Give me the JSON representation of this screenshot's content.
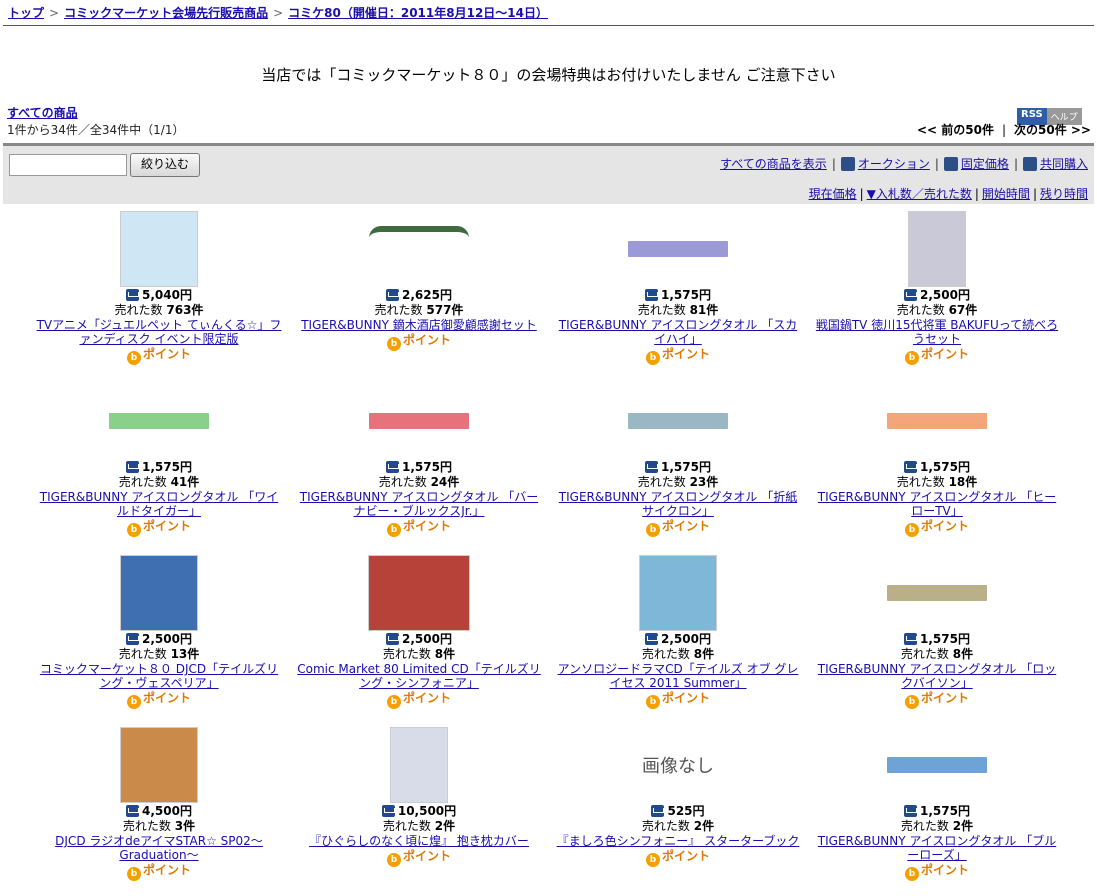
{
  "breadcrumb": [
    "トップ",
    "コミックマーケット会場先行販売商品",
    "コミケ80（開催日：2011年8月12日〜14日）"
  ],
  "notice": "当店では「コミックマーケット８０」の会場特典はお付けいたしません ご注意下さい",
  "all_items": "すべての商品",
  "count": "1件から34件／全34件中（1/1）",
  "rss": {
    "label": "RSS",
    "help": "ヘルプ"
  },
  "pager": {
    "prev": "<< 前の50件",
    "next": "次の50件 >>"
  },
  "narrow_button": "絞り込む",
  "filters": [
    "すべての商品を表示",
    "オークション",
    "固定価格",
    "共同購入"
  ],
  "sorts": [
    "現在価格",
    "▼入札数／売れた数",
    "開始時間",
    "残り時間"
  ],
  "point_label": "ポイント",
  "sold_prefix": "売れた数",
  "items": [
    {
      "price": "5,040円",
      "sold": "763件",
      "title": "TVアニメ「ジュエルペット てぃんくる☆」ファンディスク イベント限定版",
      "color": "#cfe6f5"
    },
    {
      "price": "2,625円",
      "sold": "577件",
      "title": "TIGER&BUNNY 鏑木酒店御愛顧感謝セット",
      "color": "#ffffff"
    },
    {
      "price": "1,575円",
      "sold": "81件",
      "title": "TIGER&BUNNY アイスロングタオル 「スカイハイ」",
      "color": "#9b9ad6"
    },
    {
      "price": "2,500円",
      "sold": "67件",
      "title": "戦国鍋TV 徳川15代将軍 BAKUFUって続べろうセット",
      "color": "#c9c9d8"
    },
    {
      "price": "1,575円",
      "sold": "41件",
      "title": "TIGER&BUNNY アイスロングタオル 「ワイルドタイガー」",
      "color": "#8ad08a"
    },
    {
      "price": "1,575円",
      "sold": "24件",
      "title": "TIGER&BUNNY アイスロングタオル 「バーナビー・ブルックスJr.」",
      "color": "#e8727b"
    },
    {
      "price": "1,575円",
      "sold": "23件",
      "title": "TIGER&BUNNY アイスロングタオル 「折紙サイクロン」",
      "color": "#9ab7c4"
    },
    {
      "price": "1,575円",
      "sold": "18件",
      "title": "TIGER&BUNNY アイスロングタオル 「ヒーローTV」",
      "color": "#f2a67a"
    },
    {
      "price": "2,500円",
      "sold": "13件",
      "title": "コミックマーケット８０ DJCD「テイルズリング・ヴェスペリア」",
      "color": "#3f6fb0"
    },
    {
      "price": "2,500円",
      "sold": "8件",
      "title": "Comic Market 80 Limited CD「テイルズリング・シンフォニア」",
      "color": "#b6423a"
    },
    {
      "price": "2,500円",
      "sold": "8件",
      "title": "アンソロジードラマCD「テイルズ オブ グレイセス 2011 Summer」",
      "color": "#7fb7d8"
    },
    {
      "price": "1,575円",
      "sold": "8件",
      "title": "TIGER&BUNNY アイスロングタオル 「ロックバイソン」",
      "color": "#b9b08a"
    },
    {
      "price": "4,500円",
      "sold": "3件",
      "title": "DJCD ラジオdeアイマSTAR☆ SP02〜Graduation〜",
      "color": "#c98a4a"
    },
    {
      "price": "10,500円",
      "sold": "2件",
      "title": "『ひぐらしのなく頃に煌』 抱き枕カバー",
      "color": "#d8dce8"
    },
    {
      "price": "525円",
      "sold": "2件",
      "title": "『ましろ色シンフォニー』 スターターブック",
      "color": "#ffffff",
      "noimg": "画像なし"
    },
    {
      "price": "1,575円",
      "sold": "2件",
      "title": "TIGER&BUNNY アイスロングタオル 「ブルーローズ」",
      "color": "#6fa3d6"
    }
  ]
}
